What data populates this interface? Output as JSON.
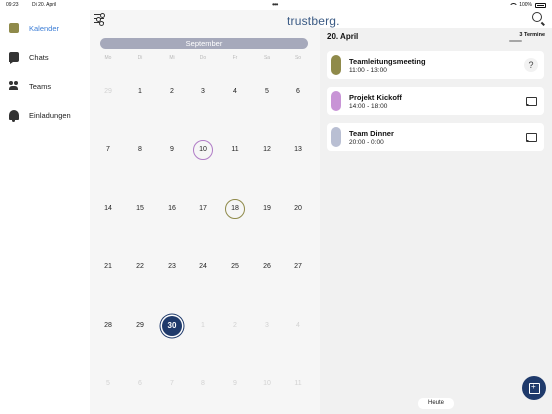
{
  "status": {
    "time": "09:23",
    "date": "Di 20. April",
    "battery": "100%",
    "dots": "•••"
  },
  "app": {
    "title": "trustberg."
  },
  "sidebar": {
    "items": [
      {
        "label": "Kalender",
        "active": true,
        "icon": "calendar-icon"
      },
      {
        "label": "Chats",
        "active": false,
        "icon": "chat-icon"
      },
      {
        "label": "Teams",
        "active": false,
        "icon": "people-icon"
      },
      {
        "label": "Einladungen",
        "active": false,
        "icon": "bell-icon"
      }
    ]
  },
  "calendar": {
    "month": "September",
    "weekdays": [
      "Mo",
      "Di",
      "Mi",
      "Do",
      "Fr",
      "Sa",
      "So"
    ],
    "weeks": [
      [
        "29",
        "1",
        "2",
        "3",
        "4",
        "5",
        "6"
      ],
      [
        "7",
        "8",
        "9",
        "10",
        "11",
        "12",
        "13"
      ],
      [
        "14",
        "15",
        "16",
        "17",
        "18",
        "19",
        "20"
      ],
      [
        "21",
        "22",
        "23",
        "24",
        "25",
        "26",
        "27"
      ],
      [
        "28",
        "29",
        "30",
        "1",
        "2",
        "3",
        "4"
      ],
      [
        "5",
        "6",
        "7",
        "8",
        "9",
        "10",
        "11"
      ]
    ],
    "faded": [
      [
        0,
        0
      ],
      [
        4,
        3
      ],
      [
        4,
        4
      ],
      [
        4,
        5
      ],
      [
        4,
        6
      ],
      [
        5,
        0
      ],
      [
        5,
        1
      ],
      [
        5,
        2
      ],
      [
        5,
        3
      ],
      [
        5,
        4
      ],
      [
        5,
        5
      ],
      [
        5,
        6
      ]
    ],
    "marked": [
      {
        "week": 1,
        "day": 3,
        "style": "ring-purple"
      },
      {
        "week": 2,
        "day": 4,
        "style": "ring-olive"
      },
      {
        "week": 4,
        "day": 2,
        "style": "today"
      }
    ]
  },
  "events_panel": {
    "date": "20. April",
    "count": "3 Termine",
    "events": [
      {
        "title": "Teamleitungsmeeting",
        "time": "11:00 - 13:00",
        "color": "#8f8a4a",
        "action": "question-icon"
      },
      {
        "title": "Projekt Kickoff",
        "time": "14:00 - 18:00",
        "color": "#c894d6",
        "action": "message-icon"
      },
      {
        "title": "Team Dinner",
        "time": "20:00 - 0:00",
        "color": "#b9bfd3",
        "action": "message-icon"
      }
    ],
    "today_button": "Heute"
  },
  "colors": {
    "accent": "#3d7ed6",
    "primary": "#1f3a6b",
    "title": "#3a5a84"
  }
}
